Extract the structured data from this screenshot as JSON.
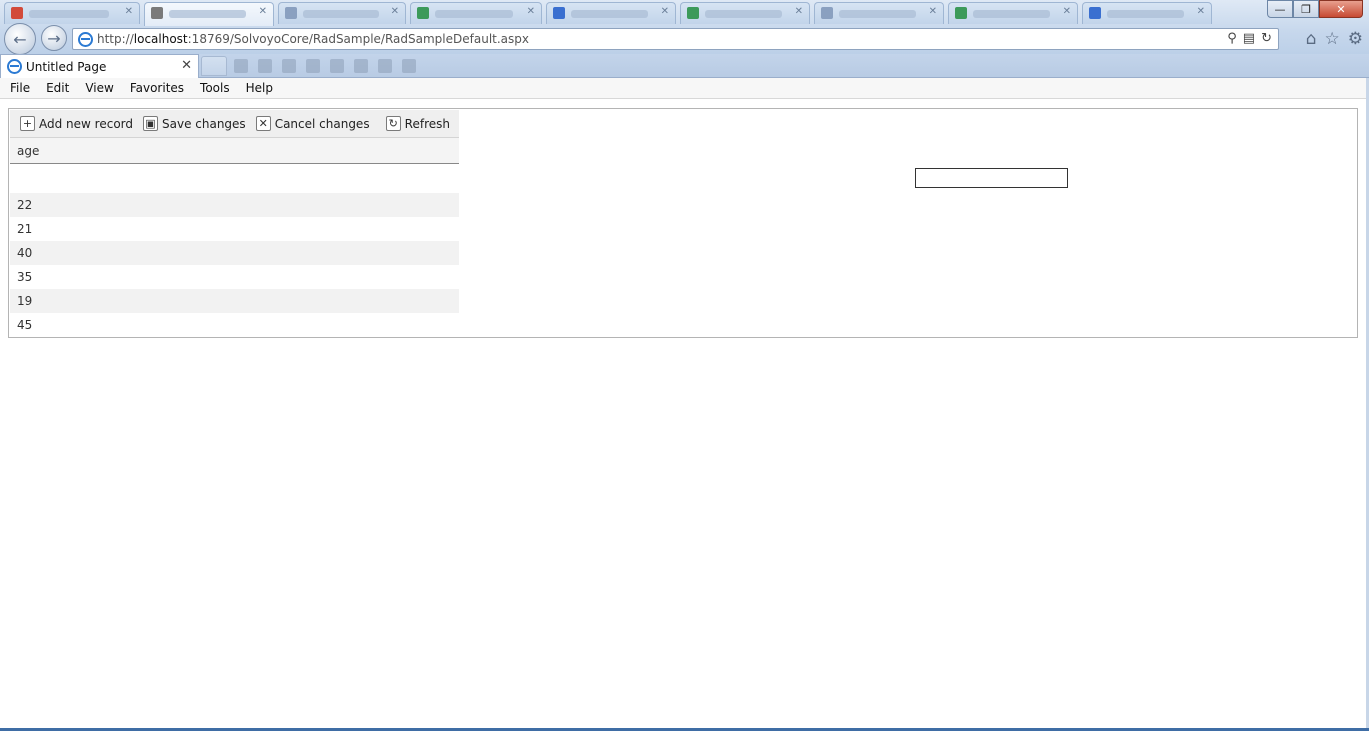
{
  "browser": {
    "address_url_prefix": "http://",
    "address_url_host": "localhost",
    "address_url_rest": ":18769/SolvoyoCore/RadSample/RadSampleDefault.aspx",
    "active_tab_title": "Untitled Page",
    "tab_close_glyph": "✕",
    "window_controls": {
      "minimize": "—",
      "restore": "❐",
      "close": "✕"
    },
    "nav": {
      "back": "←",
      "forward": "→"
    },
    "toolbar_icons": [
      "home-icon",
      "star-icon",
      "gear-icon"
    ],
    "accent_color": "#2b7ad3"
  },
  "menubar": {
    "items": [
      "File",
      "Edit",
      "View",
      "Favorites",
      "Tools",
      "Help"
    ]
  },
  "grid": {
    "commands": {
      "add": "Add new record",
      "save": "Save changes",
      "cancel": "Cancel changes",
      "refresh": "Refresh"
    },
    "column_header": "age",
    "rows": [
      "22",
      "21",
      "40",
      "35",
      "19",
      "45"
    ]
  },
  "textbox": {
    "value": ""
  }
}
